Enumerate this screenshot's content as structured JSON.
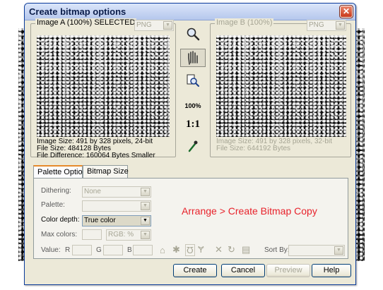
{
  "window": {
    "title": "Create bitmap options",
    "close_glyph": "✕"
  },
  "image_a": {
    "label": "Image A (100%) SELECTED",
    "format": "PNG",
    "info": [
      "Image Size: 491 by 328 pixels, 24-bit",
      "File Size: 484128 Bytes",
      "File Difference: 160064 Bytes Smaller"
    ]
  },
  "image_b": {
    "label": "Image B (100%)",
    "format": "PNG",
    "info": [
      "Image Size: 491 by 328 pixels, 32-bit",
      "File Size: 644192 Bytes"
    ]
  },
  "toolbar": {
    "zoom_icon": "magnifier-icon",
    "push_icon": "push-hand-icon",
    "zoom_region_icon": "zoom-region-icon",
    "zoom_100": "100%",
    "one_to_one": "1:1",
    "color_picker_icon": "eyedropper-icon"
  },
  "tabs": [
    {
      "label": "Palette Options",
      "active": true
    },
    {
      "label": "Bitmap Size",
      "active": false
    }
  ],
  "palette_options": {
    "dithering_label": "Dithering:",
    "dithering_value": "None",
    "palette_label": "Palette:",
    "palette_value": "",
    "color_depth_label": "Color depth:",
    "color_depth_value": "True color",
    "max_colors_label": "Max colors:",
    "max_colors_mode": "RGB: %",
    "value_label": "Value:",
    "r_label": "R",
    "g_label": "G",
    "b_label": "B",
    "sort_by_label": "Sort By:",
    "sort_by_value": ""
  },
  "annotation": "Arrange > Create Bitmap Copy",
  "buttons": {
    "create": "Create",
    "cancel": "Cancel",
    "preview": "Preview",
    "help": "Help"
  },
  "colors": {
    "accent_tab": "#e68b2c",
    "annotation": "#e8222b"
  }
}
